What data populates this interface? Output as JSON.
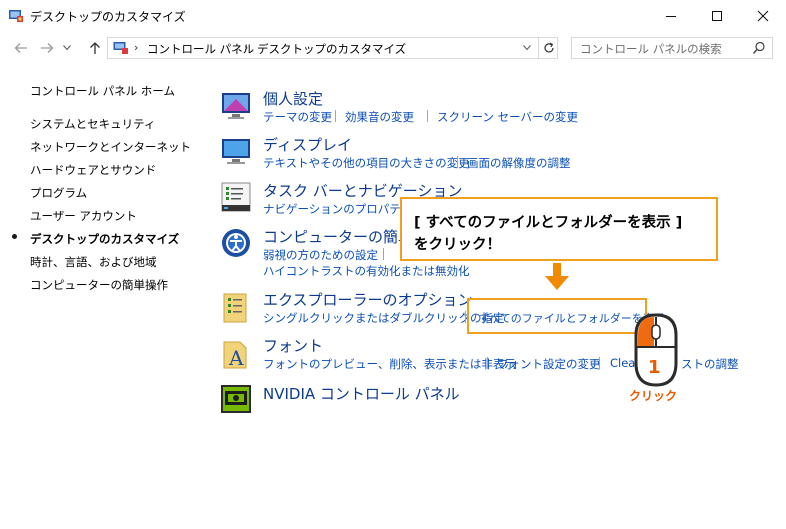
{
  "window": {
    "title": "デスクトップのカスタマイズ",
    "minimize": "minimize",
    "maximize": "maximize",
    "close": "close"
  },
  "address": {
    "crumbs": [
      "コントロール パネル",
      "デスクトップのカスタマイズ"
    ],
    "search_placeholder": "コントロール パネルの検索"
  },
  "sidebar": {
    "home": "コントロール パネル ホーム",
    "items": [
      "システムとセキュリティ",
      "ネットワークとインターネット",
      "ハードウェアとサウンド",
      "プログラム",
      "ユーザー アカウント",
      "デスクトップのカスタマイズ",
      "時計、言語、および地域",
      "コンピューターの簡単操作"
    ],
    "active_index": 5
  },
  "categories": [
    {
      "title": "個人設定",
      "icon": "personalization-icon",
      "links": [
        [
          "テーマの変更",
          "効果音の変更",
          "スクリーン セーバーの変更"
        ]
      ]
    },
    {
      "title": "ディスプレイ",
      "icon": "display-icon",
      "links": [
        [
          "テキストやその他の項目の大きさの変更",
          "画面の解像度の調整"
        ]
      ]
    },
    {
      "title": "タスク バーとナビゲーション",
      "icon": "taskbar-icon",
      "links": [
        [
          "ナビゲーションのプロパティ"
        ]
      ]
    },
    {
      "title": "コンピューターの簡単操",
      "icon": "ease-of-access-icon",
      "links": [
        [
          "弱視の方のための設定"
        ],
        [
          "ハイコントラストの有効化または無効化"
        ]
      ]
    },
    {
      "title": "エクスプローラーのオプション",
      "icon": "folder-options-icon",
      "links": [
        [
          "シングルクリックまたはダブルクリックの指定",
          "すべてのファイルとフォルダーを表示"
        ]
      ]
    },
    {
      "title": "フォント",
      "icon": "fonts-icon",
      "links": [
        [
          "フォントのプレビュー、削除、表示または非表示",
          "フォント設定の変更",
          "Clea",
          "ストの調整"
        ]
      ]
    },
    {
      "title": "NVIDIA コントロール パネル",
      "icon": "nvidia-icon",
      "links": []
    }
  ],
  "annotation": {
    "callout_line1": "[ すべてのファイルとフォルダーを表示 ]",
    "callout_line2": "をクリック！",
    "step_number": "1",
    "click_label": "クリック",
    "accent_color": "#f0a020",
    "arrow_color": "#f08a00"
  }
}
